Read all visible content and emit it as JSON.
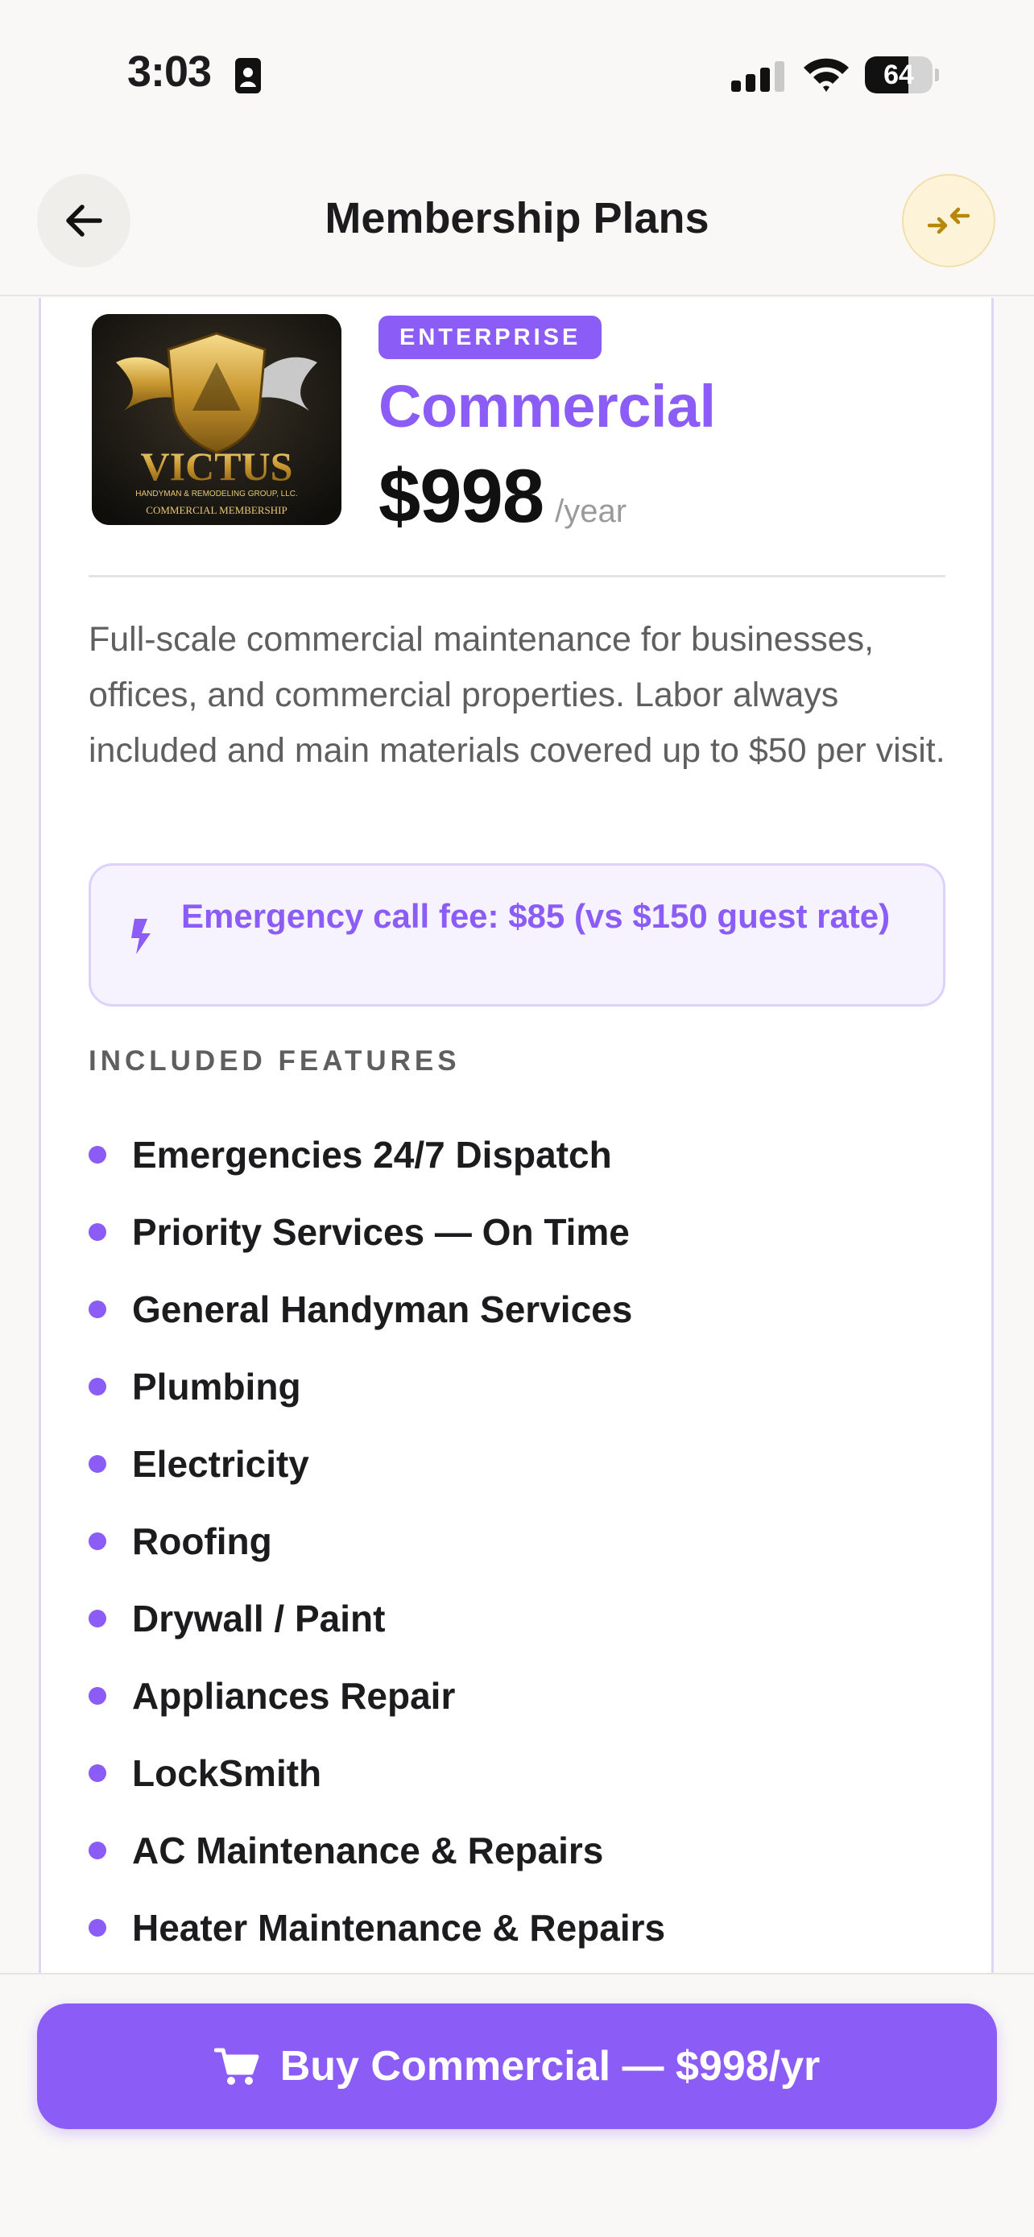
{
  "status_bar": {
    "time": "3:03",
    "battery": "64",
    "battery_level": 0.64
  },
  "header": {
    "title": "Membership Plans"
  },
  "plan": {
    "tier": "ENTERPRISE",
    "name": "Commercial",
    "price": "$998",
    "period": "/year",
    "logo": {
      "brand": "VICTUS",
      "subtitle": "HANDYMAN & REMODELING GROUP, LLC.",
      "caption": "COMMERCIAL MEMBERSHIP"
    },
    "description": "Full-scale commercial maintenance for businesses, offices, and commercial properties. Labor always included and main materials covered up to $50 per visit.",
    "emergency_fee": "Emergency call fee: $85 (vs $150 guest rate)",
    "features_heading": "INCLUDED FEATURES",
    "features": [
      "Emergencies 24/7 Dispatch",
      "Priority Services — On Time",
      "General Handyman Services",
      "Plumbing",
      "Electricity",
      "Roofing",
      "Drywall / Paint",
      "Appliances Repair",
      "LockSmith",
      "AC Maintenance & Repairs",
      "Heater Maintenance & Repairs"
    ]
  },
  "cta": {
    "label": "Buy Commercial — $998/yr"
  },
  "colors": {
    "accent": "#8b5cf6",
    "accent_soft": "#f6f3ff",
    "compare_bg": "#fdf3d8",
    "compare_icon": "#b8860b"
  }
}
